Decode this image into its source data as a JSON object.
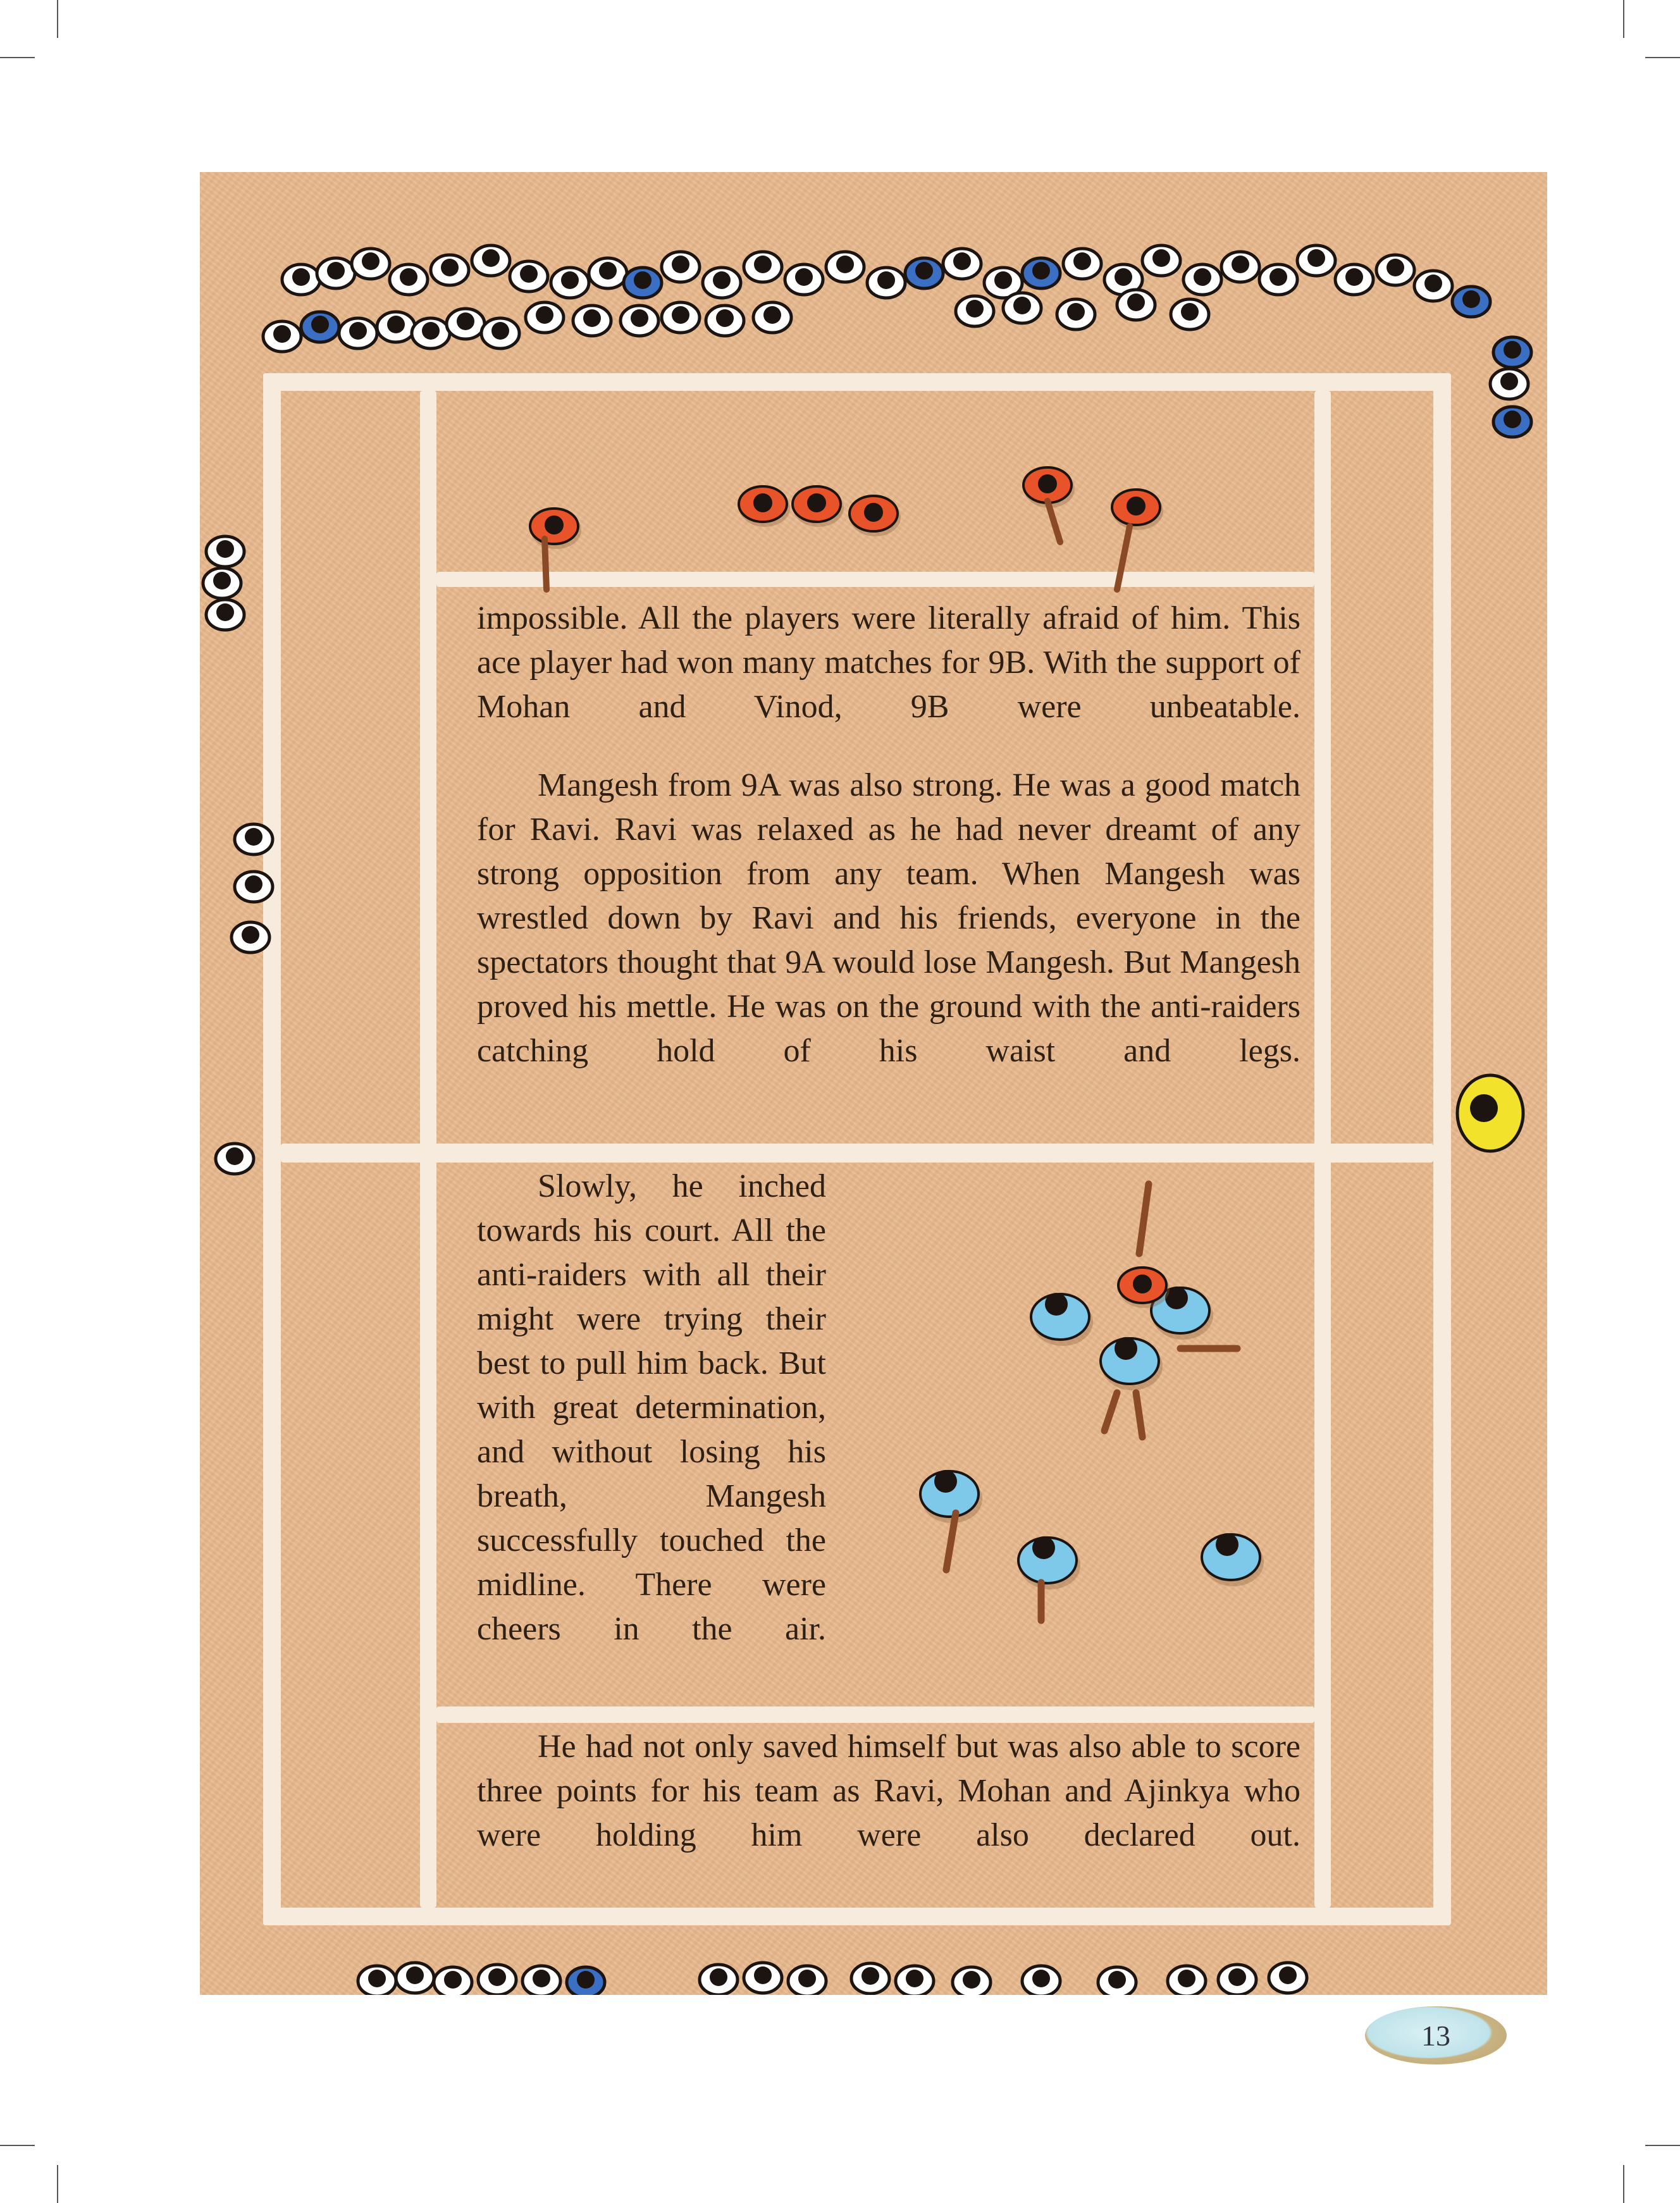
{
  "page": {
    "number": "13"
  },
  "story": {
    "paragraph_top": "impossible. All the players were literally afraid of him. This ace player had won many matches for 9B. With the support of Mohan and Vinod, 9B were unbeatable.",
    "paragraph_mangesh": "Mangesh from 9A was also strong. He was a good match for Ravi. Ravi was relaxed as he had never dreamt of any strong opposition from any team. When Mangesh was wrestled down by Ravi and his friends, everyone in the spectators thought that 9A would lose Mangesh. But Mangesh proved his mettle. He was on the ground with the anti-raiders catching hold of his waist and legs.",
    "paragraph_slowly": "Slowly, he inched towards his court. All the anti-raiders with all their might were trying their best to pull him back. But with great determination, and without losing his breath, Mangesh successfully touched the midline. There were cheers in the air.",
    "paragraph_end": "He had not only saved himself but was also able to score three points for his team as Ravi, Mohan and Ajinkya who were holding him were also declared out."
  },
  "illustration": {
    "scene": "kabaddi-court-top-view",
    "colors": {
      "court_ground": "#e8b98d",
      "court_lines": "#f6ebdd",
      "team_9b_shirts": "#e8532a",
      "team_9a_shirts": "#7ec8ea",
      "spectator_shirts": "#ffffff",
      "spectator_accent": "#3b6fc4",
      "referee_shirt": "#f2e22c"
    }
  }
}
